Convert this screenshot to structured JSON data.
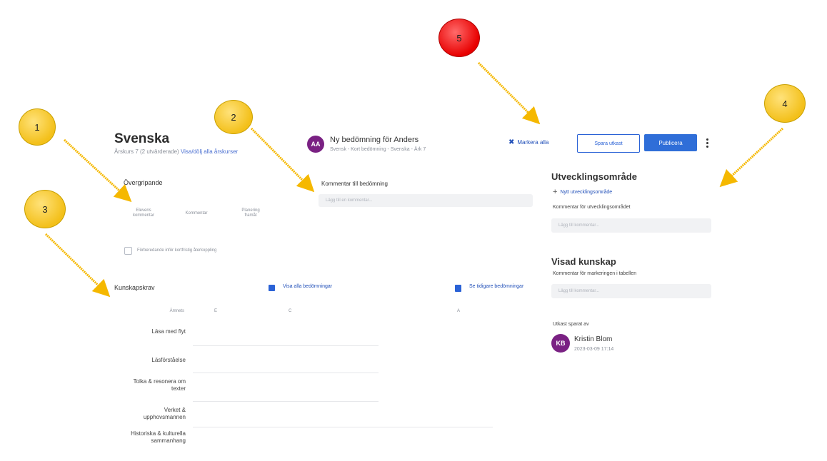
{
  "left": {
    "title": "Svenska",
    "subtitle": "Årskurs 7 (2 utvärderade)",
    "subtitle_link": "Visa/dölj alla årskurser",
    "overall_heading": "Övergripande",
    "tabs": [
      "Elevens kommentar",
      "Kommentar",
      "Planering framåt"
    ],
    "checkbox_label": "Förberedande inför kortfristig återkoppling",
    "knowledge_heading": "Kunskapskrav",
    "grade_header_label": "Ämnets",
    "grade_header_value": "E",
    "rows": [
      "Läsa med flyt",
      "Läsförståelse",
      "Tolka & resonera om texter",
      "Verket & upphovsmannen",
      "Historiska & kulturella sammanhang"
    ]
  },
  "middle": {
    "avatar_initials": "AA",
    "assessment_title": "Ny bedömning för Anders",
    "assessment_sub": "Svensk - Kort bedömning - Svenska - Ärk 7",
    "comment_label": "Kommentar till bedömning",
    "comment_placeholder": "Lägg till en kommentar...",
    "link_show_all": "Visa alla bedömningar",
    "link_previous": "Se tidigare bedömningar",
    "col_values": [
      "",
      "C",
      "A"
    ]
  },
  "header_actions": {
    "mark_all_label": "Markera alla",
    "save_label": "Spara utkast",
    "publish_label": "Publicera"
  },
  "right": {
    "dev_title": "Utvecklingsområde",
    "add_dev": "Nytt utvecklingsområde",
    "dev_comment_label": "Kommentar för utvecklingsområdet",
    "dev_placeholder": "Lägg till kommentar...",
    "shown_title": "Visad kunskap",
    "shown_comment_label": "Kommentar för markeringen i tabellen",
    "shown_placeholder": "Lägg till kommentar...",
    "draft_label": "Utkast sparat av",
    "author_initials": "KB",
    "author_name": "Kristin Blom",
    "author_time": "2023-03-09 17:14"
  },
  "badges": [
    "1",
    "2",
    "3",
    "4",
    "5"
  ],
  "colors": {
    "accent": "#2f6ed8",
    "avatar": "#7a2183",
    "badge_yellow": "#f3c01a",
    "badge_red": "#e80000",
    "arrow": "#f5b800"
  }
}
